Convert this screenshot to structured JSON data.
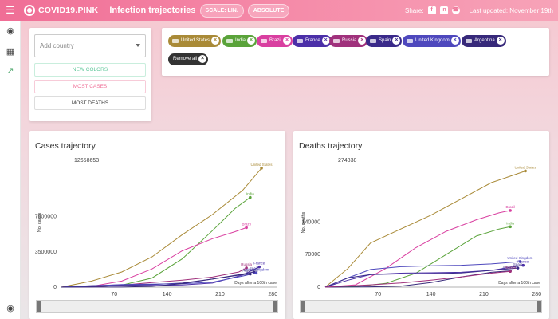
{
  "header": {
    "brand": "COVID19.PINK",
    "title": "Infection trajectories",
    "scale_button": "SCALE: LIN.",
    "mode_button": "ABSOLUTE",
    "share_label": "Share:",
    "social_icons": [
      "facebook-icon",
      "linkedin-icon",
      "whatsapp-icon"
    ],
    "last_updated": "Last updated: November 19th"
  },
  "sidebar": {
    "icons": [
      "globe-icon",
      "dashboard-icon",
      "trend-icon",
      "github-icon"
    ]
  },
  "controls": {
    "add_country_placeholder": "Add country",
    "new_colors": "NEW COLORS",
    "most_cases": "MOST CASES",
    "most_deaths": "MOST DEATHS"
  },
  "chips": [
    {
      "label": "United States",
      "color": "#a98a37"
    },
    {
      "label": "India",
      "color": "#5aa33a"
    },
    {
      "label": "Brazil",
      "color": "#d93fa0"
    },
    {
      "label": "France",
      "color": "#4b2fa8"
    },
    {
      "label": "Russia",
      "color": "#a0317c"
    },
    {
      "label": "Spain",
      "color": "#3a2a8a"
    },
    {
      "label": "United Kingdom",
      "color": "#4e48bd"
    },
    {
      "label": "Argentina",
      "color": "#37297a"
    },
    {
      "label": "Remove all",
      "color": "#333333"
    }
  ],
  "chart_data": [
    {
      "type": "line",
      "title": "Cases trajectory",
      "ylabel": "No. cases",
      "xlabel": "Days after a 100th case",
      "y_max_label": "12658653",
      "yticks": [
        0,
        3500000,
        7000000
      ],
      "ytick_labels": [
        "0",
        "3500000",
        "7000000"
      ],
      "xticks": [
        0,
        70,
        140,
        210,
        280
      ],
      "xtick_labels": [
        "0",
        "70",
        "140",
        "210",
        "280"
      ],
      "xlim": [
        0,
        285
      ],
      "ylim": [
        0,
        12658653
      ],
      "series": [
        {
          "name": "United States",
          "color": "#a98a37",
          "x": [
            0,
            40,
            80,
            120,
            160,
            200,
            240,
            265
          ],
          "y": [
            0,
            600000,
            1500000,
            3000000,
            5200000,
            7200000,
            9600000,
            11800000
          ]
        },
        {
          "name": "India",
          "color": "#5aa33a",
          "x": [
            0,
            40,
            80,
            120,
            160,
            200,
            230,
            250
          ],
          "y": [
            0,
            20000,
            200000,
            900000,
            2800000,
            5600000,
            7800000,
            8900000
          ]
        },
        {
          "name": "Brazil",
          "color": "#d93fa0",
          "x": [
            0,
            40,
            80,
            120,
            160,
            200,
            230,
            245
          ],
          "y": [
            0,
            80000,
            600000,
            1800000,
            3600000,
            4800000,
            5500000,
            5900000
          ]
        },
        {
          "name": "Russia",
          "color": "#a0317c",
          "x": [
            0,
            40,
            80,
            120,
            160,
            200,
            235,
            245
          ],
          "y": [
            0,
            20000,
            200000,
            450000,
            700000,
            1000000,
            1500000,
            1900000
          ]
        },
        {
          "name": "France",
          "color": "#4b2fa8",
          "x": [
            0,
            40,
            80,
            120,
            160,
            200,
            240,
            262
          ],
          "y": [
            0,
            80000,
            150000,
            170000,
            220000,
            400000,
            1200000,
            2000000
          ]
        },
        {
          "name": "Spain",
          "color": "#3a2a8a",
          "x": [
            0,
            40,
            80,
            120,
            160,
            200,
            240,
            255
          ],
          "y": [
            0,
            150000,
            230000,
            250000,
            400000,
            800000,
            1300000,
            1500000
          ]
        },
        {
          "name": "United Kingdom",
          "color": "#4e48bd",
          "x": [
            0,
            40,
            80,
            120,
            160,
            200,
            240,
            258
          ],
          "y": [
            0,
            120000,
            250000,
            290000,
            330000,
            500000,
            1100000,
            1400000
          ]
        },
        {
          "name": "Argentina",
          "color": "#37297a",
          "x": [
            0,
            40,
            80,
            120,
            160,
            200,
            240,
            250
          ],
          "y": [
            0,
            4000,
            10000,
            80000,
            350000,
            800000,
            1250000,
            1300000
          ]
        }
      ]
    },
    {
      "type": "line",
      "title": "Deaths trajectory",
      "ylabel": "No. deaths",
      "xlabel": "Days after a 100th case",
      "y_max_label": "274838",
      "yticks": [
        0,
        70000,
        140000
      ],
      "ytick_labels": [
        "0",
        "70000",
        "140000"
      ],
      "xticks": [
        0,
        70,
        140,
        210,
        280
      ],
      "xtick_labels": [
        "0",
        "70",
        "140",
        "210",
        "280"
      ],
      "xlim": [
        0,
        285
      ],
      "ylim": [
        0,
        274838
      ],
      "series": [
        {
          "name": "United States",
          "color": "#a98a37",
          "x": [
            0,
            30,
            60,
            100,
            140,
            180,
            220,
            265
          ],
          "y": [
            0,
            40000,
            95000,
            125000,
            155000,
            190000,
            225000,
            250000
          ]
        },
        {
          "name": "Brazil",
          "color": "#d93fa0",
          "x": [
            0,
            40,
            80,
            120,
            160,
            200,
            230,
            245
          ],
          "y": [
            0,
            5000,
            40000,
            85000,
            120000,
            145000,
            160000,
            165000
          ]
        },
        {
          "name": "India",
          "color": "#5aa33a",
          "x": [
            0,
            40,
            80,
            120,
            160,
            200,
            230,
            245
          ],
          "y": [
            0,
            1000,
            8000,
            30000,
            70000,
            110000,
            125000,
            130000
          ]
        },
        {
          "name": "United Kingdom",
          "color": "#4e48bd",
          "x": [
            0,
            30,
            60,
            100,
            140,
            180,
            220,
            258
          ],
          "y": [
            0,
            20000,
            38000,
            44000,
            46000,
            47000,
            50000,
            55000
          ]
        },
        {
          "name": "France",
          "color": "#4b2fa8",
          "x": [
            0,
            30,
            60,
            100,
            140,
            180,
            220,
            262
          ],
          "y": [
            0,
            15000,
            27000,
            30000,
            31000,
            32000,
            36000,
            47000
          ]
        },
        {
          "name": "Spain",
          "color": "#3a2a8a",
          "x": [
            0,
            30,
            60,
            100,
            140,
            180,
            220,
            255
          ],
          "y": [
            0,
            20000,
            27000,
            28500,
            29000,
            30500,
            36000,
            41000
          ]
        },
        {
          "name": "Argentina",
          "color": "#37297a",
          "x": [
            0,
            60,
            100,
            140,
            180,
            220,
            245
          ],
          "y": [
            0,
            700,
            2000,
            10000,
            22000,
            32000,
            35000
          ]
        },
        {
          "name": "Russia",
          "color": "#a0317c",
          "x": [
            0,
            60,
            100,
            140,
            180,
            220,
            245
          ],
          "y": [
            0,
            5000,
            9000,
            15000,
            22000,
            30000,
            34000
          ]
        }
      ]
    }
  ]
}
